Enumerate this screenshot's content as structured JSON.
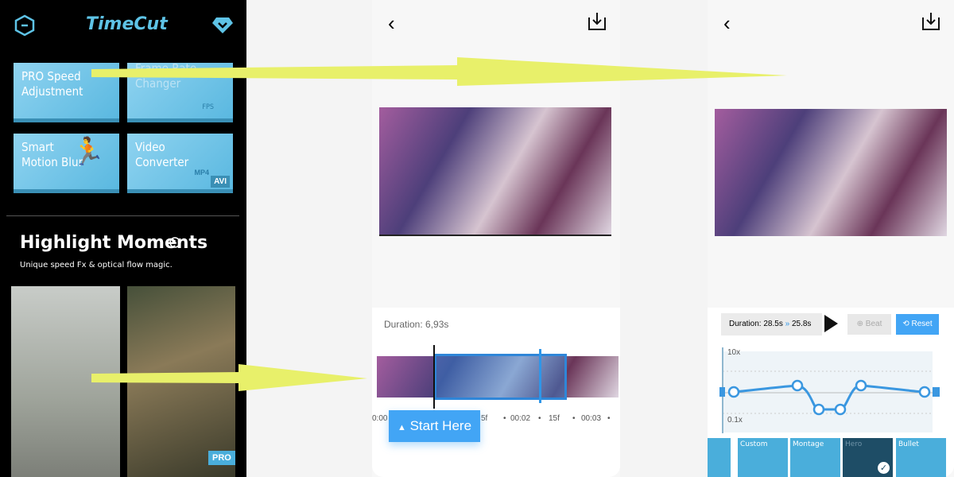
{
  "left": {
    "app_title": "TimeCut",
    "tiles": [
      {
        "label": "PRO Speed Adjustment"
      },
      {
        "label": "Frame Rate Changer"
      },
      {
        "label": "Smart Motion Blur"
      },
      {
        "label": "Video Converter",
        "badges": [
          "MP4",
          "AVI"
        ]
      }
    ],
    "fps_label": "FPS",
    "section_title": "Highlight Moments",
    "section_subtitle": "Unique speed Fx & optical flow magic.",
    "pro_badge": "PRO"
  },
  "middle": {
    "duration": "Duration: 6,93s",
    "ticks": [
      "0:00",
      "5f",
      "•",
      "00:02",
      "•",
      "15f",
      "•",
      "00:03",
      "•"
    ],
    "start_button": "Start Here"
  },
  "right": {
    "duration_from": "Duration: 28.5s",
    "duration_arrow": "»",
    "duration_to": "25.8s",
    "beat_button": "Beat",
    "reset_button": "Reset",
    "y_max": "10x",
    "y_min": "0.1x",
    "presets": [
      "",
      "Custom",
      "Montage",
      "Hero",
      "Bullet"
    ],
    "selected_preset": "Hero"
  },
  "colors": {
    "accent": "#2f96e8",
    "arrow": "#e8f06a",
    "tile": "#5ab8e0"
  }
}
